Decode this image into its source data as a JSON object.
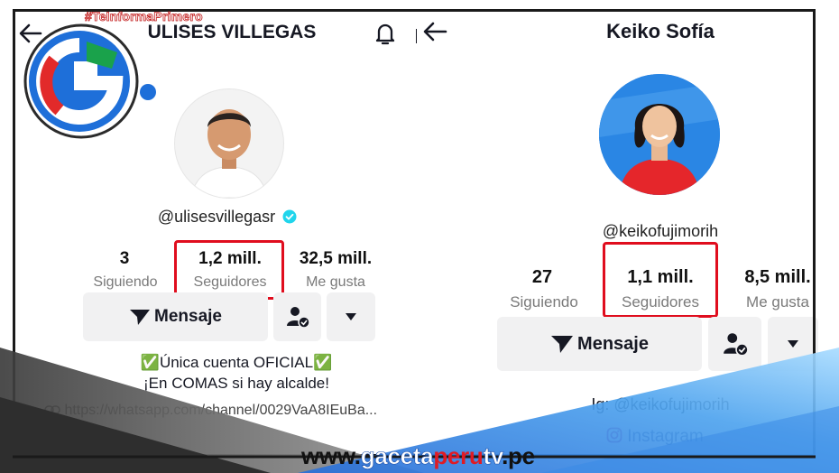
{
  "watermark": {
    "hashtag": "#TeInformaPrimero",
    "site": "www.gacetaperutv.pe",
    "site_prefix": "www.",
    "site_a": "gaceta",
    "site_b": "peru",
    "site_c": "tv",
    "site_d": ".pe"
  },
  "left_profile": {
    "name": "ULISES VILLEGAS",
    "handle": "@ulisesvillegasr",
    "verified": true,
    "stats": [
      {
        "value": "3",
        "label": "Siguiendo"
      },
      {
        "value": "1,2 mill.",
        "label": "Seguidores"
      },
      {
        "value": "32,5 mill.",
        "label": "Me gusta"
      }
    ],
    "message_button": "Mensaje",
    "bio_line1": "✅Única cuenta OFICIAL✅",
    "bio_line2": "¡En COMAS si hay alcalde!",
    "link": "https://whatsapp.com/channel/0029VaA8IEuBa..."
  },
  "right_profile": {
    "name": "Keiko Sofía",
    "handle": "@keikofujimorih",
    "stats": [
      {
        "value": "27",
        "label": "Siguiendo"
      },
      {
        "value": "1,1 mill.",
        "label": "Seguidores"
      },
      {
        "value": "8,5 mill.",
        "label": "Me gusta"
      }
    ],
    "message_button": "Mensaje",
    "bio_ig": "Ig: @keikofujimorih",
    "instagram_link": "Instagram"
  },
  "colors": {
    "highlight_red": "#e00d1e",
    "verified_blue": "#20d5ec",
    "logo_blue": "#1e6fd9",
    "logo_red": "#e22a2a",
    "logo_green": "#1aa24b",
    "site_red": "#e01b24"
  }
}
